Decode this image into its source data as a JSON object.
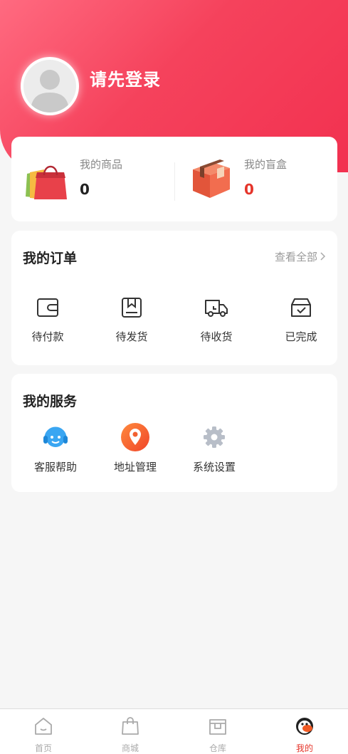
{
  "header": {
    "login_prompt": "请先登录"
  },
  "assets": [
    {
      "label": "我的商品",
      "value": "0",
      "icon": "shopping-bag-icon"
    },
    {
      "label": "我的盲盒",
      "value": "0",
      "icon": "mystery-box-icon"
    }
  ],
  "orders": {
    "title": "我的订单",
    "view_all": "查看全部",
    "items": [
      {
        "label": "待付款",
        "icon": "wallet-icon"
      },
      {
        "label": "待发货",
        "icon": "package-icon"
      },
      {
        "label": "待收货",
        "icon": "truck-icon"
      },
      {
        "label": "已完成",
        "icon": "box-check-icon"
      }
    ]
  },
  "services": {
    "title": "我的服务",
    "items": [
      {
        "label": "客服帮助",
        "icon": "headset-icon"
      },
      {
        "label": "地址管理",
        "icon": "location-pin-icon"
      },
      {
        "label": "系统设置",
        "icon": "gear-icon"
      }
    ]
  },
  "tabbar": {
    "items": [
      {
        "label": "首页",
        "icon": "home-icon",
        "active": false
      },
      {
        "label": "商城",
        "icon": "shopping-bag-icon",
        "active": false
      },
      {
        "label": "仓库",
        "icon": "warehouse-icon",
        "active": false
      },
      {
        "label": "我的",
        "icon": "mascot-icon",
        "active": true
      }
    ]
  },
  "colors": {
    "brand": "#f23150",
    "accent_red": "#e5352b",
    "background": "#f6f6f6"
  }
}
